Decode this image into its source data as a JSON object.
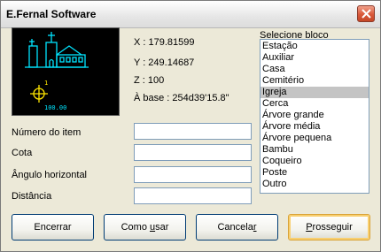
{
  "window": {
    "title": "E.Fernal Software"
  },
  "preview": {
    "number_label": "1",
    "scale_label": "100.00"
  },
  "coords": {
    "x": "X : 179.81599",
    "y": "Y : 249.14687",
    "z": "Z : 100",
    "angle": "À base : 254d39'15.8\""
  },
  "fields": [
    {
      "label": "Número do item",
      "value": ""
    },
    {
      "label": "Cota",
      "value": ""
    },
    {
      "label": "Ângulo horizontal",
      "value": ""
    },
    {
      "label": "Distância",
      "value": ""
    }
  ],
  "list": {
    "label": "Selecione bloco",
    "selected": "Igreja",
    "items": [
      "Estação",
      "Auxiliar",
      "Casa",
      "Cemitério",
      "Igreja",
      "Cerca",
      "Árvore grande",
      "Árvore média",
      "Árvore pequena",
      "Bambu",
      "Coqueiro",
      "Poste",
      "Outro"
    ]
  },
  "buttons": {
    "encerrar": {
      "pre": "Encerrar",
      "ul": "",
      "post": ""
    },
    "como_usar": {
      "pre": "Como ",
      "ul": "u",
      "post": "sar"
    },
    "cancelar": {
      "pre": "Cancela",
      "ul": "r",
      "post": ""
    },
    "prosseguir": {
      "pre": "",
      "ul": "P",
      "post": "rosseguir"
    }
  },
  "colors": {
    "cad_cyan": "#00e5ff",
    "cad_yellow": "#ffe600",
    "selection": "#c4c4c4"
  }
}
